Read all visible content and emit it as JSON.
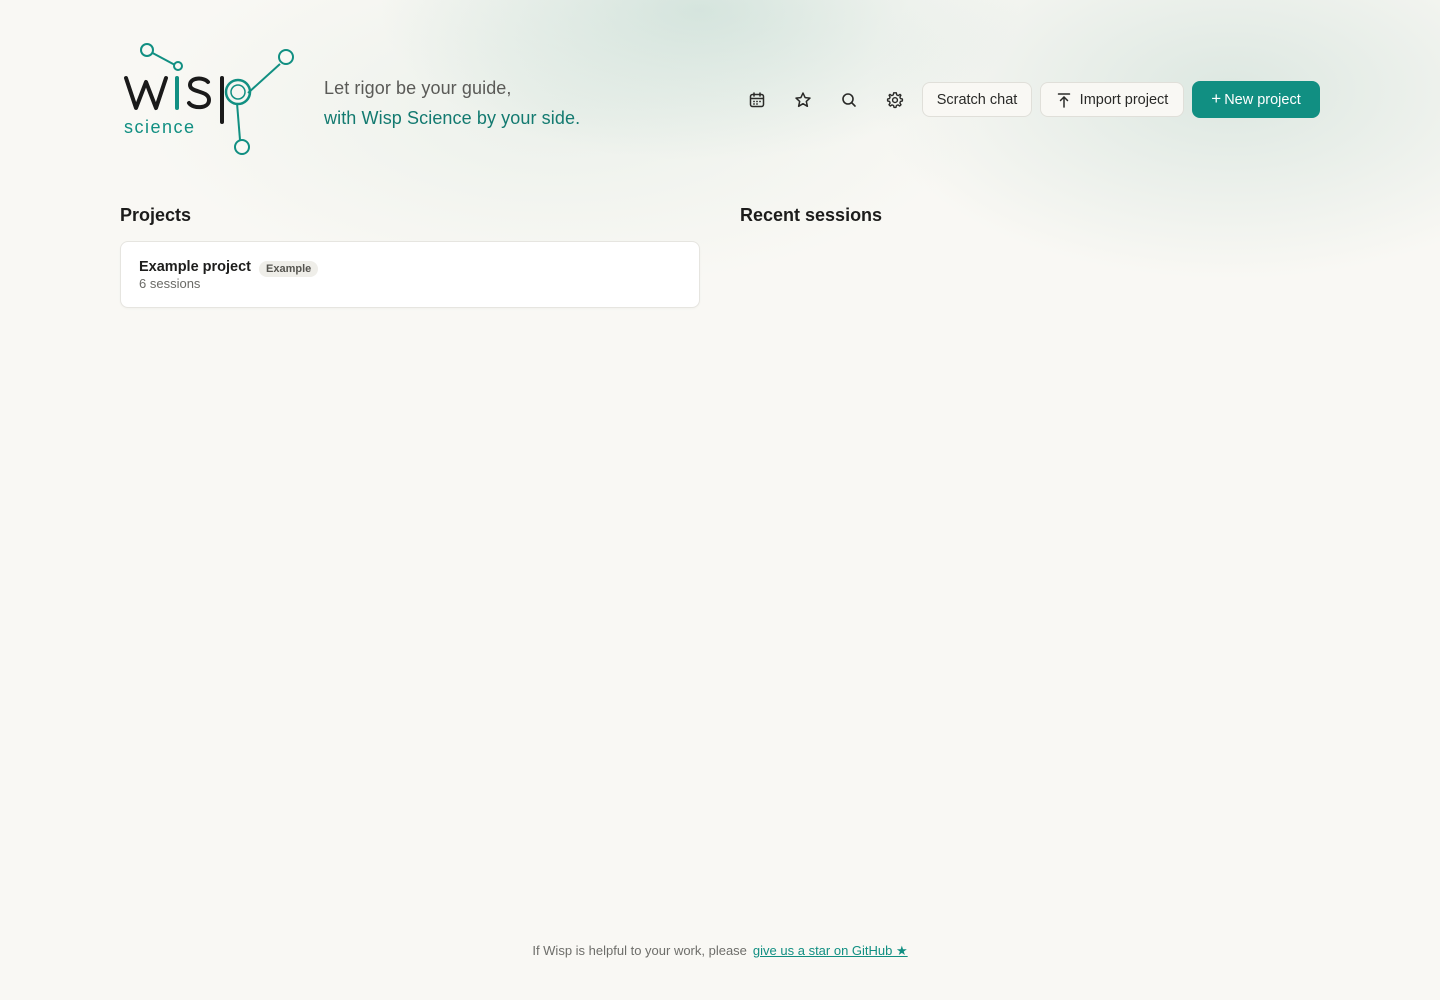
{
  "brand": {
    "logo_wordmark": "WISP",
    "logo_subtitle": "science",
    "accent_color": "#118f82",
    "logo_dark_color": "#1a1a1a"
  },
  "tagline": {
    "line1": "Let rigor be your guide,",
    "line2": "with Wisp Science by your side."
  },
  "toolbar": {
    "icons": [
      "calendar-icon",
      "star-icon",
      "search-icon",
      "gear-icon"
    ],
    "scratch_chat_label": "Scratch chat",
    "import_project_label": "Import project",
    "new_project_label": "New project",
    "new_project_plus": "+"
  },
  "projects": {
    "title": "Projects",
    "items": [
      {
        "name": "Example project",
        "badge": "Example",
        "sessions": "6 sessions"
      }
    ]
  },
  "recent_sessions": {
    "title": "Recent sessions"
  },
  "footer": {
    "text": "If Wisp is helpful to your work, please",
    "link_text": "give us a star on GitHub ★"
  }
}
